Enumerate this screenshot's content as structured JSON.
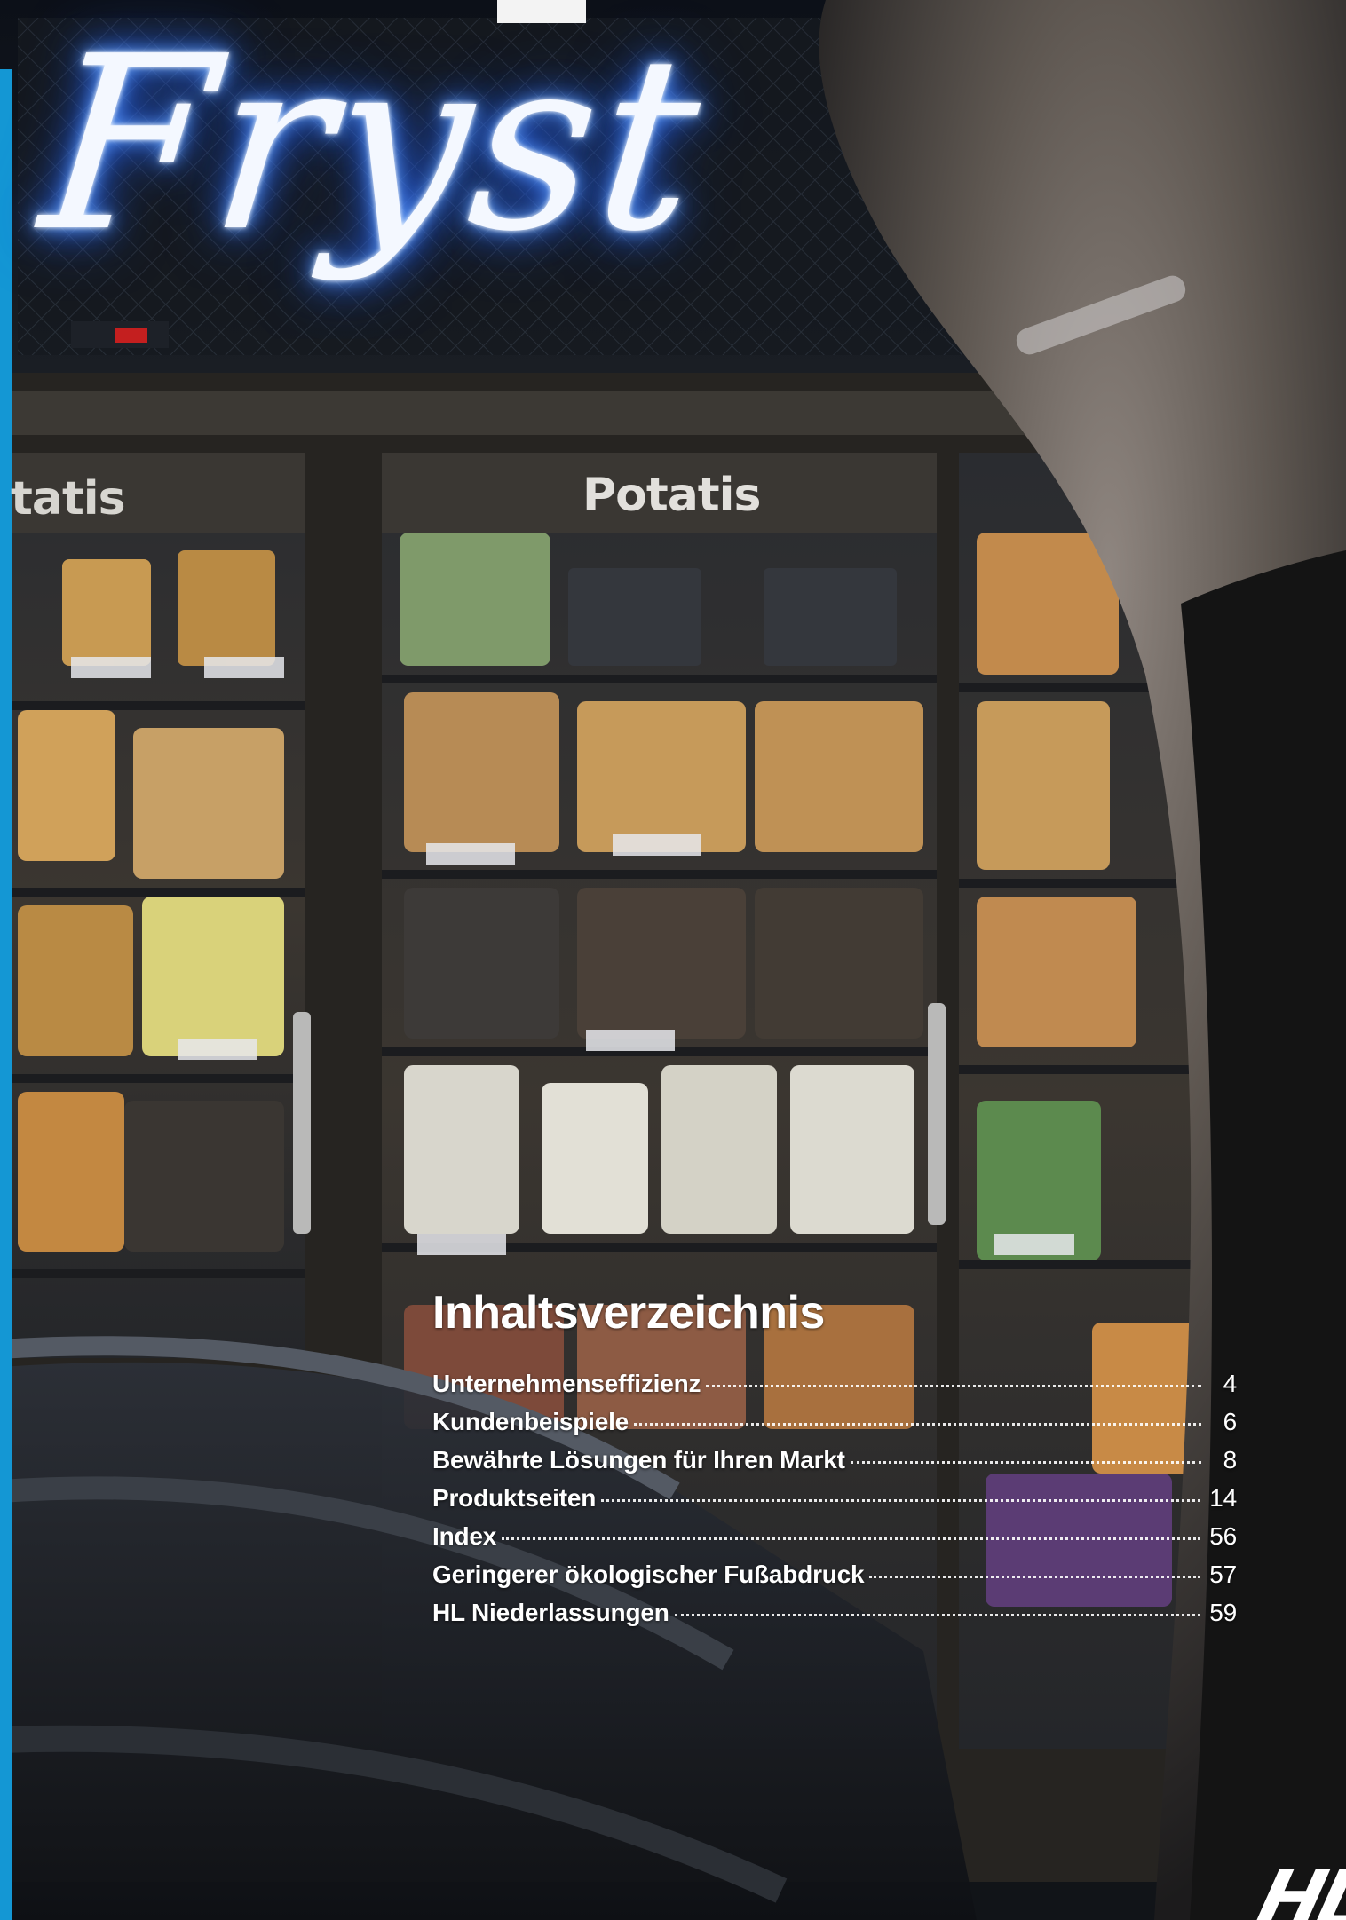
{
  "photo": {
    "neon_sign": "Fryst",
    "freezer_labels": {
      "left": "tatis",
      "center": "Potatis"
    }
  },
  "toc": {
    "title": "Inhaltsverzeichnis",
    "items": [
      {
        "label": "Unternehmenseffizienz",
        "page": "4"
      },
      {
        "label": "Kundenbeispiele",
        "page": "6"
      },
      {
        "label": "Bewährte Lösungen für Ihren Markt",
        "page": "8"
      },
      {
        "label": "Produktseiten",
        "page": "14"
      },
      {
        "label": "Index",
        "page": "56"
      },
      {
        "label": "Geringerer ökologischer Fußabdruck",
        "page": "57"
      },
      {
        "label": "HL Niederlassungen",
        "page": "59"
      }
    ]
  },
  "logo": {
    "text": "HL"
  },
  "colors": {
    "accent": "#1497d4",
    "neon_glow": "#2f6fff"
  }
}
